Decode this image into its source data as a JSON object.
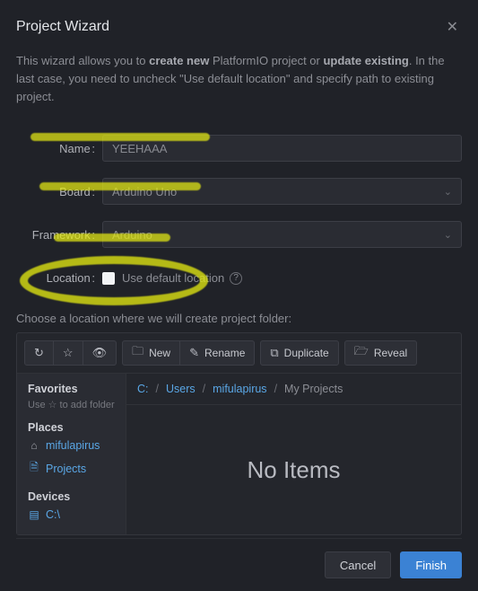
{
  "title": "Project Wizard",
  "intro": {
    "p1a": "This wizard allows you to ",
    "b1": "create new",
    "p1b": " PlatformIO project or ",
    "b2": "update existing",
    "p1c": ". In the last case, you need to uncheck \"Use default location\" and specify path to existing project."
  },
  "labels": {
    "name": "Name",
    "board": "Board",
    "framework": "Framework",
    "location": "Location"
  },
  "fields": {
    "name_value": "YEEHAAA",
    "board_value": "Arduino Uno",
    "framework_value": "Arduino"
  },
  "location": {
    "checkbox_checked": false,
    "text": "Use default location"
  },
  "choose_text": "Choose a location where we will create project folder:",
  "toolbar": {
    "refresh": "↻",
    "star": "☆",
    "eye": "👁",
    "new": "New",
    "rename": "Rename",
    "duplicate": "Duplicate",
    "reveal": "Reveal"
  },
  "sidebar": {
    "favorites_head": "Favorites",
    "favorites_sub": "Use ☆ to add folder",
    "places_head": "Places",
    "place_user": "mifulapirus",
    "place_projects": "Projects",
    "devices_head": "Devices",
    "device_c": "C:\\"
  },
  "breadcrumbs": {
    "c": "C:",
    "users": "Users",
    "user": "mifulapirus",
    "current": "My Projects"
  },
  "main": {
    "no_items": "No Items"
  },
  "footer": {
    "cancel": "Cancel",
    "finish": "Finish"
  }
}
